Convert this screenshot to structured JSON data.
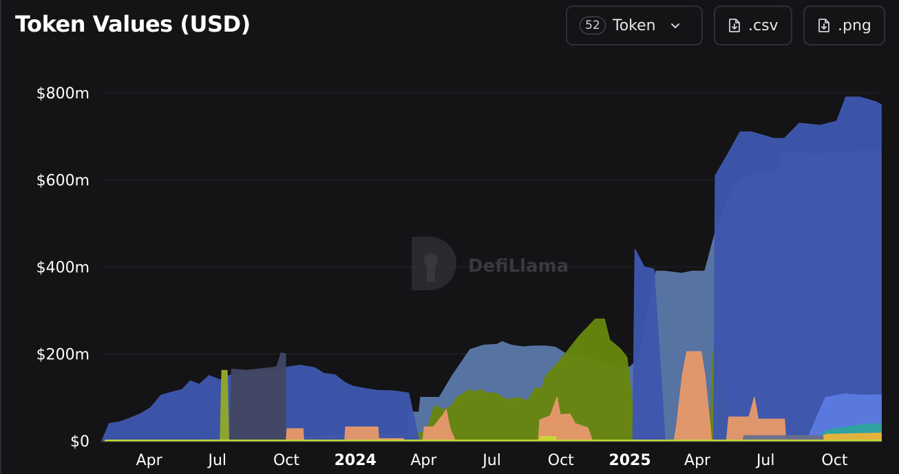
{
  "header": {
    "title": "Token Values (USD)",
    "token_count": "52",
    "token_label": "Token",
    "csv_label": ".csv",
    "png_label": ".png"
  },
  "watermark": {
    "text": "DefiLlama"
  },
  "chart_data": {
    "type": "area",
    "stacked": true,
    "title": "Token Values (USD)",
    "xlabel": "",
    "ylabel": "",
    "ylim": [
      0,
      800000000
    ],
    "yticks": [
      {
        "value": 0,
        "label": "$0"
      },
      {
        "value": 200000000,
        "label": "$200m"
      },
      {
        "value": 400000000,
        "label": "$400m"
      },
      {
        "value": 600000000,
        "label": "$600m"
      },
      {
        "value": 800000000,
        "label": "$800m"
      }
    ],
    "xlim": [
      "2023-01-28",
      "2025-12-02"
    ],
    "xticks": [
      {
        "date": "2023-04-01",
        "label": "Apr",
        "bold": false
      },
      {
        "date": "2023-07-01",
        "label": "Jul",
        "bold": false
      },
      {
        "date": "2023-10-01",
        "label": "Oct",
        "bold": false
      },
      {
        "date": "2024-01-01",
        "label": "2024",
        "bold": true
      },
      {
        "date": "2024-04-01",
        "label": "Apr",
        "bold": false
      },
      {
        "date": "2024-07-01",
        "label": "Jul",
        "bold": false
      },
      {
        "date": "2024-10-01",
        "label": "Oct",
        "bold": false
      },
      {
        "date": "2025-01-01",
        "label": "2025",
        "bold": true
      },
      {
        "date": "2025-04-01",
        "label": "Apr",
        "bold": false
      },
      {
        "date": "2025-07-01",
        "label": "Jul",
        "bold": false
      },
      {
        "date": "2025-10-01",
        "label": "Oct",
        "bold": false
      }
    ],
    "grid": true,
    "legend": "none",
    "colors": {
      "background": "#141417",
      "grid": "#24252a",
      "axis_text": "#ffffff"
    },
    "series": [
      {
        "color": "#5a77a6",
        "points": [
          [
            "2024-03-10",
            0
          ],
          [
            "2024-03-12",
            66
          ],
          [
            "2024-03-26",
            66
          ],
          [
            "2024-03-28",
            100
          ],
          [
            "2024-04-22",
            100
          ],
          [
            "2024-05-10",
            152
          ],
          [
            "2024-05-29",
            200
          ],
          [
            "2024-06-02",
            210
          ],
          [
            "2024-06-20",
            220
          ],
          [
            "2024-07-08",
            222
          ],
          [
            "2024-07-15",
            228
          ],
          [
            "2024-07-27",
            220
          ],
          [
            "2024-08-11",
            216
          ],
          [
            "2024-08-25",
            218
          ],
          [
            "2024-09-11",
            218
          ],
          [
            "2024-09-24",
            215
          ],
          [
            "2024-10-08",
            200
          ],
          [
            "2024-10-21",
            196
          ],
          [
            "2024-11-12",
            190
          ],
          [
            "2024-11-25",
            180
          ],
          [
            "2024-12-07",
            170
          ],
          [
            "2024-12-20",
            168
          ],
          [
            "2025-01-01",
            170
          ],
          [
            "2025-01-14",
            190
          ],
          [
            "2025-01-25",
            300
          ],
          [
            "2025-02-05",
            390
          ],
          [
            "2025-02-16",
            390
          ],
          [
            "2025-03-11",
            385
          ],
          [
            "2025-03-25",
            390
          ],
          [
            "2025-04-11",
            390
          ],
          [
            "2025-04-25",
            480
          ],
          [
            "2025-05-13",
            560
          ],
          [
            "2025-05-27",
            600
          ],
          [
            "2025-06-09",
            610
          ],
          [
            "2025-06-22",
            616
          ],
          [
            "2025-07-15",
            620
          ],
          [
            "2025-07-26",
            665
          ],
          [
            "2025-08-11",
            665
          ],
          [
            "2025-09-01",
            660
          ],
          [
            "2025-09-16",
            660
          ],
          [
            "2025-10-13",
            665
          ],
          [
            "2025-11-01",
            665
          ],
          [
            "2025-11-24",
            668
          ],
          [
            "2025-12-02",
            665
          ],
          [
            "2025-12-02",
            0
          ]
        ]
      },
      {
        "color": "#66850d",
        "points": [
          [
            "2023-06-10",
            0
          ],
          [
            "2023-06-12",
            3
          ],
          [
            "2023-10-02",
            4
          ],
          [
            "2023-11-20",
            12
          ],
          [
            "2024-01-01",
            15
          ],
          [
            "2024-03-12",
            16
          ],
          [
            "2024-04-05",
            20
          ],
          [
            "2024-04-15",
            80
          ],
          [
            "2024-04-29",
            72
          ],
          [
            "2024-05-08",
            80
          ],
          [
            "2024-05-15",
            100
          ],
          [
            "2024-05-25",
            110
          ],
          [
            "2024-06-01",
            118
          ],
          [
            "2024-06-08",
            112
          ],
          [
            "2024-06-15",
            118
          ],
          [
            "2024-06-25",
            110
          ],
          [
            "2024-07-06",
            110
          ],
          [
            "2024-07-21",
            95
          ],
          [
            "2024-08-05",
            100
          ],
          [
            "2024-08-18",
            92
          ],
          [
            "2024-08-28",
            122
          ],
          [
            "2024-09-05",
            120
          ],
          [
            "2024-09-11",
            150
          ],
          [
            "2024-09-25",
            175
          ],
          [
            "2024-10-09",
            205
          ],
          [
            "2024-10-25",
            240
          ],
          [
            "2024-11-16",
            280
          ],
          [
            "2024-11-28",
            280
          ],
          [
            "2024-12-05",
            232
          ],
          [
            "2024-12-19",
            212
          ],
          [
            "2024-12-28",
            192
          ],
          [
            "2025-01-10",
            0
          ]
        ]
      },
      {
        "color": "#66850d",
        "points": [
          [
            "2025-04-18",
            0
          ],
          [
            "2025-04-22",
            205
          ],
          [
            "2025-04-27",
            215
          ],
          [
            "2025-05-10",
            95
          ],
          [
            "2025-05-20",
            0
          ]
        ]
      },
      {
        "color": "#3e57ad",
        "points": [
          [
            "2023-01-28",
            0
          ],
          [
            "2023-02-07",
            40
          ],
          [
            "2023-02-21",
            44
          ],
          [
            "2023-03-06",
            52
          ],
          [
            "2023-03-20",
            62
          ],
          [
            "2023-04-03",
            76
          ],
          [
            "2023-04-17",
            105
          ],
          [
            "2023-05-01",
            112
          ],
          [
            "2023-05-15",
            118
          ],
          [
            "2023-05-26",
            138
          ],
          [
            "2023-06-07",
            130
          ],
          [
            "2023-06-20",
            150
          ],
          [
            "2023-07-05",
            140
          ],
          [
            "2023-07-19",
            152
          ],
          [
            "2023-08-02",
            158
          ],
          [
            "2023-08-16",
            158
          ],
          [
            "2023-09-13",
            160
          ],
          [
            "2023-10-04",
            170
          ],
          [
            "2023-10-19",
            174
          ],
          [
            "2023-11-08",
            168
          ],
          [
            "2023-11-20",
            155
          ],
          [
            "2023-12-05",
            152
          ],
          [
            "2023-12-18",
            134
          ],
          [
            "2023-12-28",
            126
          ],
          [
            "2024-01-15",
            120
          ],
          [
            "2024-01-31",
            116
          ],
          [
            "2024-02-20",
            115
          ],
          [
            "2024-03-12",
            110
          ],
          [
            "2024-03-26",
            0
          ]
        ]
      },
      {
        "color": "#3e57ad",
        "points": [
          [
            "2025-01-05",
            0
          ],
          [
            "2025-01-08",
            440
          ],
          [
            "2025-01-20",
            400
          ],
          [
            "2025-02-02",
            395
          ],
          [
            "2025-02-17",
            0
          ]
        ]
      },
      {
        "color": "#3e57ad",
        "points": [
          [
            "2025-04-23",
            0
          ],
          [
            "2025-04-25",
            610
          ],
          [
            "2025-05-12",
            660
          ],
          [
            "2025-05-28",
            710
          ],
          [
            "2025-06-12",
            710
          ],
          [
            "2025-07-12",
            695
          ],
          [
            "2025-07-26",
            695
          ],
          [
            "2025-08-15",
            730
          ],
          [
            "2025-09-12",
            725
          ],
          [
            "2025-10-04",
            735
          ],
          [
            "2025-10-16",
            790
          ],
          [
            "2025-11-04",
            790
          ],
          [
            "2025-11-24",
            780
          ],
          [
            "2025-12-02",
            773
          ],
          [
            "2025-12-02",
            0
          ]
        ]
      },
      {
        "color": "#414763",
        "points": [
          [
            "2023-07-18",
            0
          ],
          [
            "2023-07-20",
            165
          ],
          [
            "2023-08-08",
            162
          ],
          [
            "2023-08-29",
            166
          ],
          [
            "2023-09-18",
            170
          ],
          [
            "2023-09-24",
            202
          ],
          [
            "2023-09-30",
            200
          ],
          [
            "2023-09-30",
            0
          ]
        ]
      },
      {
        "color": "#93a82a",
        "points": [
          [
            "2023-07-05",
            0
          ],
          [
            "2023-07-07",
            162
          ],
          [
            "2023-07-14",
            162
          ],
          [
            "2023-07-16",
            0
          ]
        ]
      },
      {
        "color": "#e5986a",
        "points": [
          [
            "2023-10-01",
            0
          ],
          [
            "2023-10-02",
            28
          ],
          [
            "2023-10-23",
            28
          ],
          [
            "2023-10-24",
            0
          ],
          [
            "2023-12-18",
            0
          ],
          [
            "2023-12-19",
            32
          ],
          [
            "2024-01-31",
            32
          ],
          [
            "2024-02-01",
            5
          ],
          [
            "2024-03-05",
            5
          ],
          [
            "2024-03-06",
            0
          ],
          [
            "2024-03-31",
            0
          ],
          [
            "2024-04-02",
            32
          ],
          [
            "2024-04-14",
            32
          ],
          [
            "2024-04-27",
            60
          ],
          [
            "2024-05-01",
            72
          ],
          [
            "2024-05-06",
            30
          ],
          [
            "2024-05-13",
            0
          ],
          [
            "2024-09-01",
            0
          ],
          [
            "2024-09-03",
            48
          ],
          [
            "2024-09-17",
            58
          ],
          [
            "2024-09-26",
            100
          ],
          [
            "2024-09-30",
            60
          ],
          [
            "2024-10-13",
            62
          ],
          [
            "2024-10-20",
            40
          ],
          [
            "2024-11-06",
            30
          ],
          [
            "2024-11-12",
            0
          ],
          [
            "2025-03-01",
            0
          ],
          [
            "2025-03-04",
            30
          ],
          [
            "2025-03-12",
            150
          ],
          [
            "2025-03-18",
            205
          ],
          [
            "2025-04-06",
            205
          ],
          [
            "2025-04-11",
            150
          ],
          [
            "2025-04-20",
            0
          ],
          [
            "2025-05-10",
            0
          ],
          [
            "2025-05-13",
            55
          ],
          [
            "2025-06-09",
            55
          ],
          [
            "2025-06-16",
            100
          ],
          [
            "2025-06-21",
            50
          ],
          [
            "2025-07-26",
            50
          ],
          [
            "2025-07-28",
            0
          ]
        ]
      },
      {
        "color": "#5a7ae0",
        "points": [
          [
            "2025-08-25",
            0
          ],
          [
            "2025-09-06",
            50
          ],
          [
            "2025-09-19",
            100
          ],
          [
            "2025-10-14",
            108
          ],
          [
            "2025-11-07",
            105
          ],
          [
            "2025-12-02",
            106
          ],
          [
            "2025-12-02",
            0
          ]
        ]
      },
      {
        "color": "#2fa3a0",
        "points": [
          [
            "2025-09-05",
            0
          ],
          [
            "2025-09-20",
            25
          ],
          [
            "2025-11-08",
            38
          ],
          [
            "2025-12-02",
            40
          ],
          [
            "2025-12-02",
            0
          ]
        ]
      },
      {
        "color": "#e7b43b",
        "points": [
          [
            "2025-09-01",
            0
          ],
          [
            "2025-09-20",
            15
          ],
          [
            "2025-12-02",
            18
          ],
          [
            "2025-12-02",
            0
          ]
        ]
      },
      {
        "color": "#6b6e8a",
        "points": [
          [
            "2025-06-01",
            0
          ],
          [
            "2025-06-02",
            12
          ],
          [
            "2025-09-15",
            12
          ],
          [
            "2025-09-16",
            0
          ]
        ]
      },
      {
        "color": "#c7d936",
        "points": [
          [
            "2024-09-03",
            0
          ],
          [
            "2024-09-04",
            10
          ],
          [
            "2024-09-24",
            10
          ],
          [
            "2024-09-25",
            0
          ]
        ]
      },
      {
        "color": "#c7d936",
        "points": [
          [
            "2023-02-01",
            0
          ],
          [
            "2023-02-02",
            2
          ],
          [
            "2025-12-02",
            2
          ],
          [
            "2025-12-02",
            0
          ]
        ]
      }
    ]
  }
}
